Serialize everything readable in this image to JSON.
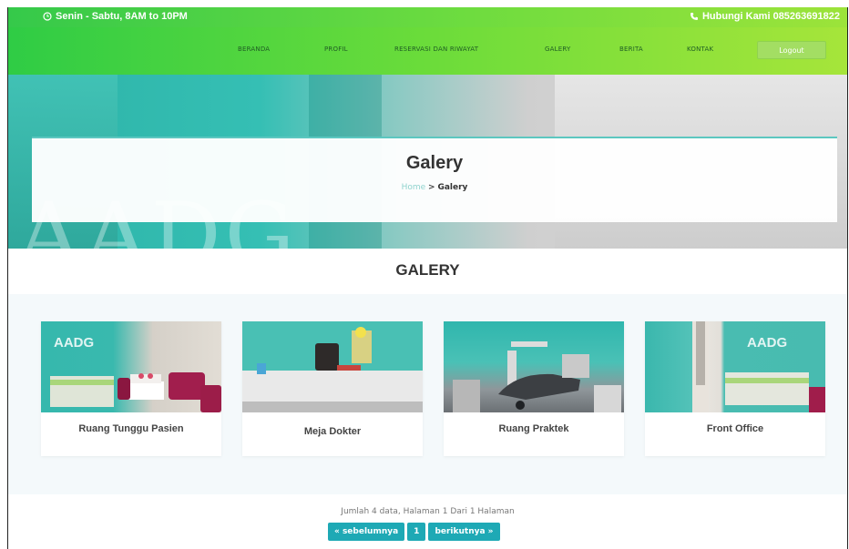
{
  "topbar": {
    "hours": "Senin - Sabtu, 8AM to 10PM",
    "contact": "Hubungi Kami 085263691822"
  },
  "nav": {
    "items": [
      "BERANDA",
      "PROFIL",
      "RESERVASI DAN RIWAYAT",
      "GALERY",
      "BERITA",
      "KONTAK"
    ],
    "logout": "Logout"
  },
  "hero": {
    "title": "Galery",
    "breadcrumb_home": "Home",
    "breadcrumb_sep": ">",
    "breadcrumb_current": "Galery",
    "watermark": "AADG"
  },
  "section": {
    "title": "GALERY"
  },
  "gallery": [
    {
      "caption": "Ruang Tunggu Pasien",
      "logo": "AADG"
    },
    {
      "caption": "Meja Dokter"
    },
    {
      "caption": "Ruang Praktek"
    },
    {
      "caption": "Front Office",
      "logo": "AADG"
    }
  ],
  "pagination": {
    "info": "Jumlah 4 data, Halaman 1 Dari 1 Halaman",
    "prev": "« sebelumnya",
    "page": "1",
    "next": "berikutnya »"
  },
  "colors": {
    "green_start": "#2fcc45",
    "green_end": "#a6e53a",
    "teal": "#1ea9b5"
  }
}
